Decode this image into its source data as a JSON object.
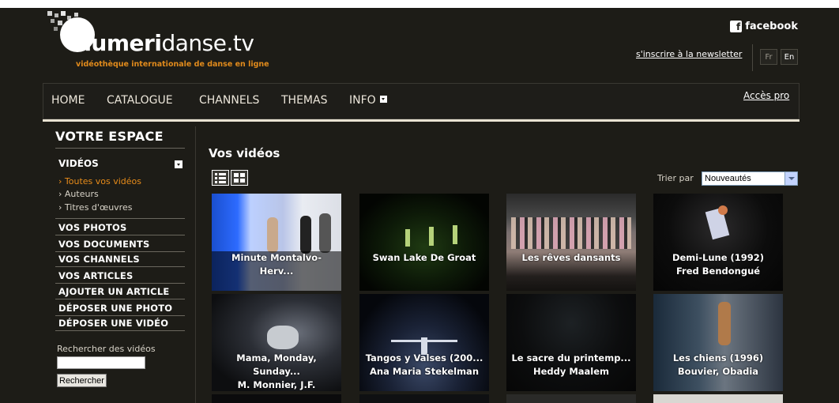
{
  "header": {
    "logo_bold": "numeri",
    "logo_rest": "danse.tv",
    "tagline": "vidéothèque internationale de danse en ligne",
    "facebook_label": "facebook",
    "newsletter_link": "s'inscrire à la newsletter",
    "lang_fr": "Fr",
    "lang_en": "En"
  },
  "nav": {
    "items": [
      "HOME",
      "CATALOGUE",
      "CHANNELS",
      "THEMAS",
      "INFO"
    ],
    "acces_pro": "Accès pro"
  },
  "sidebar": {
    "title": "VOTRE ESPACE",
    "videos_header": "VIDÉOS",
    "videos_sub": [
      "Toutes vos vidéos",
      "Auteurs",
      "Titres d'œuvres"
    ],
    "items": [
      "VOS PHOTOS",
      "VOS DOCUMENTS",
      "VOS CHANNELS",
      "VOS ARTICLES",
      "AJOUTER UN ARTICLE",
      "DÉPOSER UNE PHOTO",
      "DÉPOSER UNE VIDÉO"
    ],
    "search_label": "Rechercher des vidéos",
    "search_value": "",
    "search_button": "Rechercher"
  },
  "main": {
    "title": "Vos vidéos",
    "sort_label": "Trier par",
    "sort_value": "Nouveautés",
    "videos": [
      {
        "line1": "Minute Montalvo-",
        "line2": "Herv...",
        "line3": ""
      },
      {
        "line1": "Swan Lake De Groat",
        "line2": "",
        "line3": ""
      },
      {
        "line1": "Les rêves dansants",
        "line2": "",
        "line3": ""
      },
      {
        "line1": "Demi-Lune (1992)",
        "line2": "Fred Bendongué",
        "line3": ""
      },
      {
        "line1": "Mama, Monday,",
        "line2": "Sunday...",
        "line3": "M. Monnier, J.F."
      },
      {
        "line1": "Tangos y Valses (200...",
        "line2": "Ana Maria Stekelman",
        "line3": ""
      },
      {
        "line1": "Le sacre du printemp...",
        "line2": "Heddy Maalem",
        "line3": ""
      },
      {
        "line1": "Les chiens (1996)",
        "line2": "Bouvier, Obadia",
        "line3": ""
      }
    ]
  }
}
